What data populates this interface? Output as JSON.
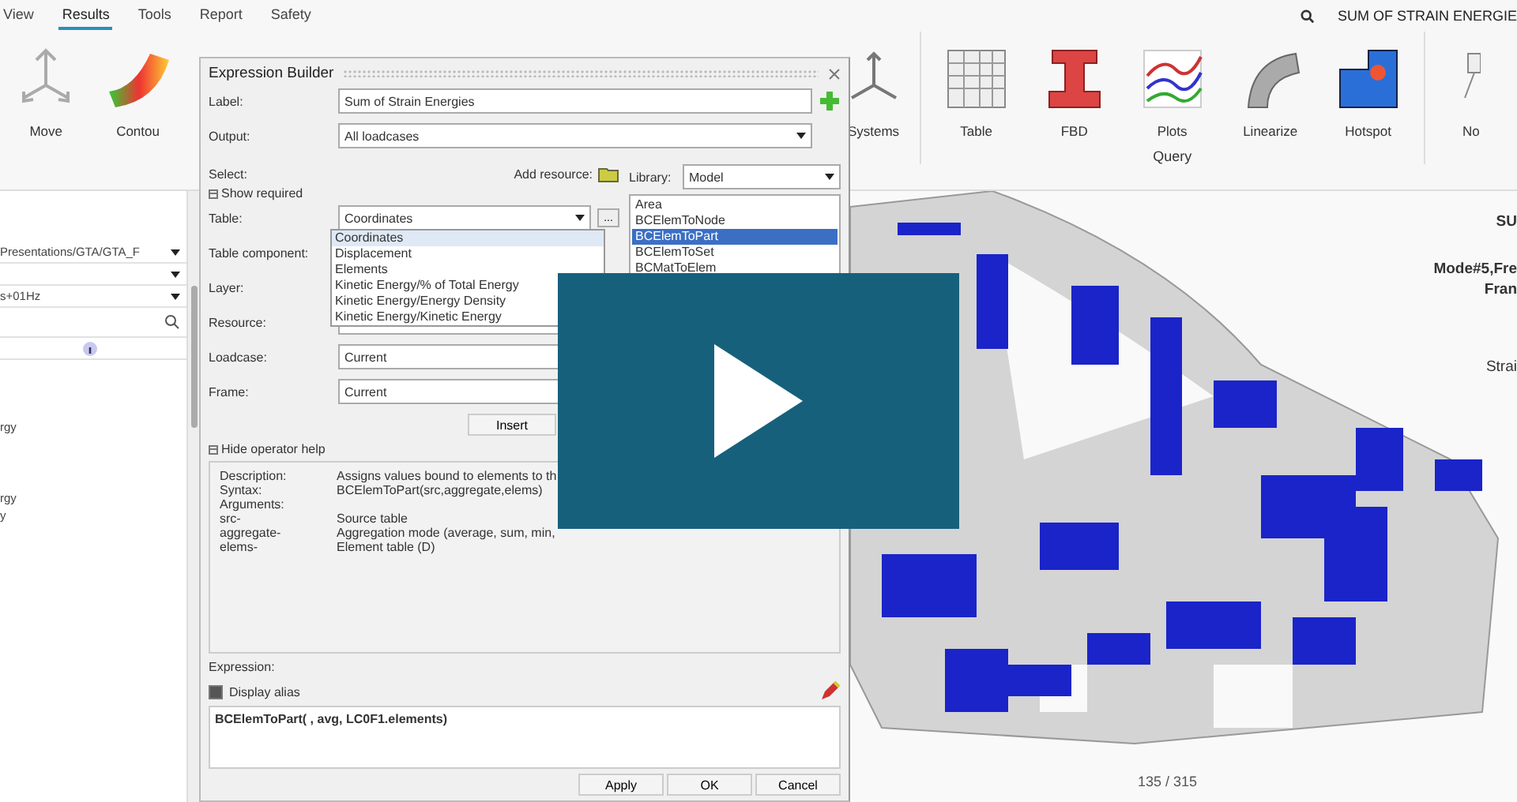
{
  "menu": [
    {
      "label": "View",
      "selected": false
    },
    {
      "label": "Results",
      "selected": true
    },
    {
      "label": "Tools",
      "selected": false
    },
    {
      "label": "Report",
      "selected": false
    },
    {
      "label": "Safety",
      "selected": false
    }
  ],
  "search": {
    "value": "SUM OF STRAIN ENERGIE"
  },
  "ribbon": {
    "left": [
      {
        "label": "Move",
        "kind": "move"
      },
      {
        "label": "Contou",
        "kind": "contour"
      }
    ],
    "right": [
      {
        "label": "Systems",
        "kind": "systems"
      }
    ],
    "query": {
      "label": "Query",
      "tools": [
        {
          "label": "Table",
          "kind": "table"
        },
        {
          "label": "FBD",
          "kind": "fbd"
        },
        {
          "label": "Plots",
          "kind": "plots"
        },
        {
          "label": "Linearize",
          "kind": "linearize"
        },
        {
          "label": "Hotspot",
          "kind": "hotspot"
        }
      ]
    },
    "end": [
      {
        "label": "No",
        "kind": "note"
      }
    ]
  },
  "left_panel": {
    "path": "Presentations/GTA/GTA_F",
    "frequency": "s+01Hz",
    "tree": [
      "rgy",
      "rgy",
      "y"
    ]
  },
  "dialog": {
    "title": "Expression Builder",
    "label": {
      "label": "Label:",
      "value": "Sum of Strain Energies"
    },
    "output": {
      "label": "Output:",
      "value": "All loadcases"
    },
    "select": "Select:",
    "add_resource": "Add resource:",
    "library": {
      "label": "Library:",
      "value": "Model",
      "items": [
        {
          "label": "Area",
          "selected": false
        },
        {
          "label": "BCElemToNode",
          "selected": false
        },
        {
          "label": "BCElemToPart",
          "selected": true
        },
        {
          "label": "BCElemToSet",
          "selected": false
        },
        {
          "label": "BCMatToElem",
          "selected": false
        }
      ]
    },
    "show_required": {
      "label": "Show required",
      "expanded": true
    },
    "fields": [
      {
        "label": "Table:",
        "value": "Coordinates"
      },
      {
        "label": "Table component:"
      },
      {
        "label": "Layer:"
      },
      {
        "label": "Resource:"
      },
      {
        "label": "Loadcase:",
        "value": "Current"
      },
      {
        "label": "Frame:",
        "value": "Current"
      }
    ],
    "table_options": [
      {
        "label": "Coordinates",
        "selected": true
      },
      {
        "label": "Displacement",
        "selected": false
      },
      {
        "label": "Elements",
        "selected": false
      },
      {
        "label": "Kinetic Energy/% of Total Energy",
        "selected": false
      },
      {
        "label": "Kinetic Energy/Energy Density",
        "selected": false
      },
      {
        "label": "Kinetic Energy/Kinetic Energy",
        "selected": false
      }
    ],
    "browse": "...",
    "insert": "Insert",
    "operator_help": {
      "label": "Hide operator help",
      "expanded": true,
      "rows": [
        {
          "term": "Description:",
          "text": "Assigns values bound to elements to th"
        },
        {
          "term": "Syntax:",
          "text": "BCElemToPart(src,aggregate,elems)"
        },
        {
          "term": "Arguments:",
          "text": ""
        },
        {
          "term": "src-",
          "text": "Source table"
        },
        {
          "term": "aggregate-",
          "text": "Aggregation mode (average, sum, min,"
        },
        {
          "term": "elems-",
          "text": "Element table (D)"
        }
      ]
    },
    "expression": {
      "label": "Expression:",
      "display_alias": {
        "label": "Display alias",
        "checked": true
      },
      "value": "BCElemToPart( , avg, LC0F1.elements)"
    },
    "buttons": [
      "Apply",
      "OK",
      "Cancel"
    ]
  },
  "viewport": {
    "legend": [
      "SU",
      "Mode#5,Fre",
      "Fran",
      "Strai"
    ],
    "frame_counter": "135 / 315"
  }
}
